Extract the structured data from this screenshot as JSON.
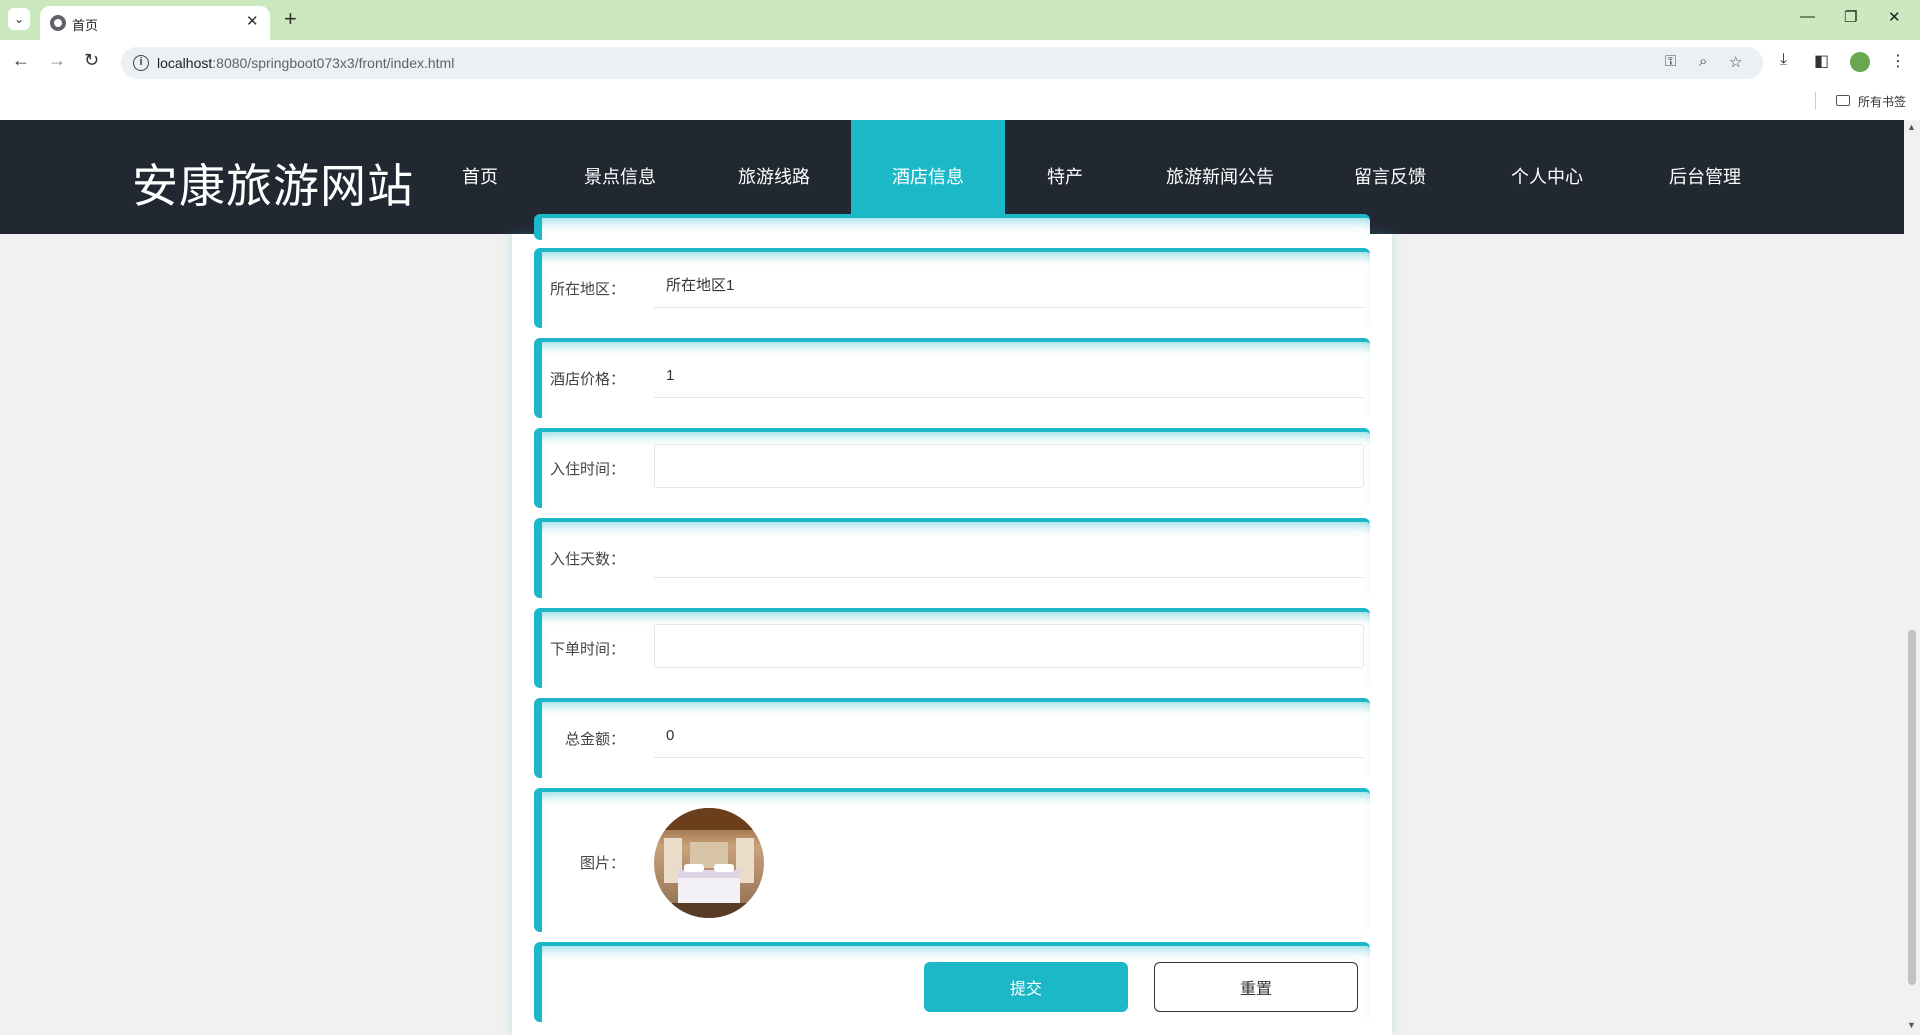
{
  "browser": {
    "tab_title": "首页",
    "url_host": "localhost",
    "url_rest": ":8080/springboot073x3/front/index.html",
    "bookmarks_label": "所有书签"
  },
  "site": {
    "logo": "安康旅游网站",
    "nav": [
      {
        "label": "首页"
      },
      {
        "label": "景点信息"
      },
      {
        "label": "旅游线路"
      },
      {
        "label": "酒店信息",
        "active": true
      },
      {
        "label": "特产"
      },
      {
        "label": "旅游新闻公告"
      },
      {
        "label": "留言反馈"
      },
      {
        "label": "个人中心"
      },
      {
        "label": "后台管理"
      }
    ],
    "accent_color": "#1cb8c8",
    "header_color": "#222831"
  },
  "form": {
    "region": {
      "label": "所在地区：",
      "value": "所在地区1"
    },
    "price": {
      "label": "酒店价格：",
      "value": "1"
    },
    "checkin_time": {
      "label": "入住时间：",
      "value": ""
    },
    "days": {
      "label": "入住天数：",
      "value": ""
    },
    "order_time": {
      "label": "下单时间：",
      "value": ""
    },
    "total": {
      "label": "总金额：",
      "value": "0"
    },
    "image": {
      "label": "图片："
    },
    "submit_label": "提交",
    "reset_label": "重置"
  }
}
